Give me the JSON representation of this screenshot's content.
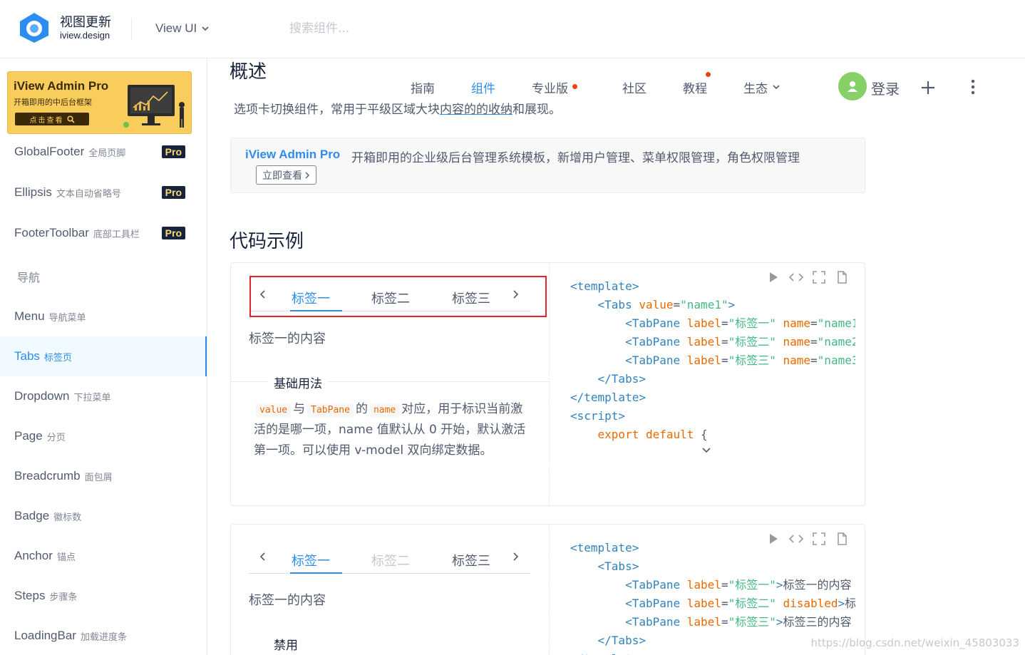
{
  "header": {
    "brand_title": "视图更新",
    "brand_sub": "iview.design",
    "version_label": "View UI",
    "search_placeholder": "搜索组件..."
  },
  "banner": {
    "title": "iView Admin Pro",
    "subtitle": "开箱即用的中后台框架",
    "button": "点击查看"
  },
  "sidebar": {
    "items": [
      {
        "label": "GlobalFooter",
        "sub": "全局页脚",
        "pro": "Pro"
      },
      {
        "label": "Ellipsis",
        "sub": "文本自动省略号",
        "pro": "Pro"
      },
      {
        "label": "FooterToolbar",
        "sub": "底部工具栏",
        "pro": "Pro"
      },
      {
        "group": "导航"
      },
      {
        "label": "Menu",
        "sub": "导航菜单"
      },
      {
        "label": "Tabs",
        "sub": "标签页",
        "active": true
      },
      {
        "label": "Dropdown",
        "sub": "下拉菜单"
      },
      {
        "label": "Page",
        "sub": "分页"
      },
      {
        "label": "Breadcrumb",
        "sub": "面包屑"
      },
      {
        "label": "Badge",
        "sub": "徽标数"
      },
      {
        "label": "Anchor",
        "sub": "锚点"
      },
      {
        "label": "Steps",
        "sub": "步骤条"
      },
      {
        "label": "LoadingBar",
        "sub": "加载进度条"
      }
    ]
  },
  "topnav": {
    "guide": "指南",
    "components": "组件",
    "pro": "专业版",
    "community": "社区",
    "tutorial": "教程",
    "ecosystem": "生态",
    "login": "登录"
  },
  "main": {
    "title": "概述",
    "desc_before": "选项卡切换组件，常用于平级区域大块",
    "desc_highlight": "内容的的收纳",
    "desc_after": "和展现。",
    "pro_box_title": "iView Admin Pro",
    "pro_box_text": "开箱即用的企业级后台管理系统模板，新增用户管理、菜单权限管理，角色权限管理",
    "pro_box_btn": "立即查看",
    "section_title": "代码示例"
  },
  "demo1": {
    "tabs": [
      "标签一",
      "标签二",
      "标签三"
    ],
    "content": "标签一的内容",
    "legend": "基础用法",
    "desc": {
      "tag1": "value",
      "t1": "与",
      "tag2": "TabPane",
      "t2": "的",
      "tag3": "name",
      "t3": "对应，用于标识当前激活的是哪一项，name 值默认从 0 开始，默认激活第一项。可以使用 v-model 双向绑定数据。"
    }
  },
  "demo2": {
    "tabs": [
      "标签一",
      "标签二",
      "标签三"
    ],
    "content": "标签一的内容",
    "legend": "禁用"
  },
  "watermark": "https://blog.csdn.net/weixin_45803033",
  "colors": {
    "primary": "#2d8cf0",
    "redbox": "#e0262b",
    "avatar": "#87d068",
    "badge_dot": "#ed4014"
  }
}
